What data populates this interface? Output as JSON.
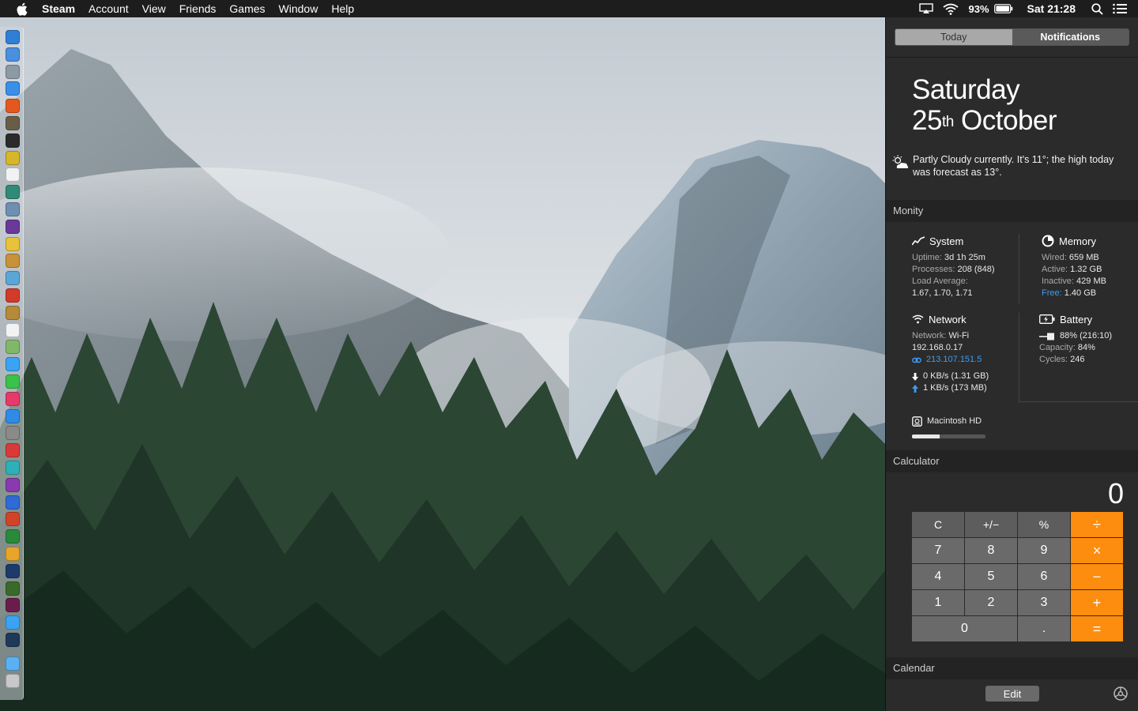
{
  "menubar": {
    "app_name": "Steam",
    "items": [
      "Account",
      "View",
      "Friends",
      "Games",
      "Window",
      "Help"
    ],
    "battery_percent": "93%",
    "clock": "Sat 21:28"
  },
  "notification_center": {
    "tabs": {
      "today": "Today",
      "notifications": "Notifications"
    },
    "date": {
      "weekday": "Saturday",
      "day": "25",
      "suffix": "th",
      "month": "October"
    },
    "weather": "Partly Cloudy currently. It's 11°; the high today was forecast as 13°.",
    "monity": {
      "header": "Monity",
      "system": {
        "title": "System",
        "uptime_label": "Uptime:",
        "uptime": "3d 1h 25m",
        "processes_label": "Processes:",
        "processes": "208 (848)",
        "load_label": "Load Average:",
        "load": "1.67, 1.70, 1.71"
      },
      "memory": {
        "title": "Memory",
        "wired_label": "Wired:",
        "wired": "659 MB",
        "active_label": "Active:",
        "active": "1.32 GB",
        "inactive_label": "Inactive:",
        "inactive": "429 MB",
        "free_label": "Free:",
        "free": "1.40 GB"
      },
      "network": {
        "title": "Network",
        "network_label": "Network:",
        "network": "Wi-Fi",
        "local_ip": "192.168.0.17",
        "public_ip": "213.107.151.5",
        "down": "0 KB/s (1.31 GB)",
        "up": "1 KB/s (173 MB)"
      },
      "battery": {
        "title": "Battery",
        "level": "88% (216:10)",
        "capacity_label": "Capacity:",
        "capacity": "84%",
        "cycles_label": "Cycles:",
        "cycles": "246"
      },
      "disk": {
        "name": "Macintosh HD",
        "used_fraction": 0.38
      }
    },
    "calculator": {
      "header": "Calculator",
      "display": "0",
      "keys": [
        {
          "label": "C",
          "kind": "fn"
        },
        {
          "label": "+/−",
          "kind": "fn"
        },
        {
          "label": "%",
          "kind": "fn"
        },
        {
          "label": "÷",
          "kind": "op"
        },
        {
          "label": "7",
          "kind": "num"
        },
        {
          "label": "8",
          "kind": "num"
        },
        {
          "label": "9",
          "kind": "num"
        },
        {
          "label": "×",
          "kind": "op"
        },
        {
          "label": "4",
          "kind": "num"
        },
        {
          "label": "5",
          "kind": "num"
        },
        {
          "label": "6",
          "kind": "num"
        },
        {
          "label": "−",
          "kind": "op"
        },
        {
          "label": "1",
          "kind": "num"
        },
        {
          "label": "2",
          "kind": "num"
        },
        {
          "label": "3",
          "kind": "num"
        },
        {
          "label": "+",
          "kind": "op"
        },
        {
          "label": "0",
          "kind": "num-wide"
        },
        {
          "label": ".",
          "kind": "num"
        },
        {
          "label": "=",
          "kind": "op"
        }
      ]
    },
    "calendar_header": "Calendar",
    "edit_label": "Edit"
  },
  "dock": {
    "icons": [
      {
        "name": "safari-icon",
        "color": "#2f7fd6"
      },
      {
        "name": "finder-icon",
        "color": "#4a8fe0"
      },
      {
        "name": "launchpad-icon",
        "color": "#8c9aa6"
      },
      {
        "name": "safari-compass-icon",
        "color": "#3a8fe6"
      },
      {
        "name": "firefox-icon",
        "color": "#e5581d"
      },
      {
        "name": "app-icon",
        "color": "#6a5d48"
      },
      {
        "name": "app-icon",
        "color": "#2b2b2b"
      },
      {
        "name": "app-icon",
        "color": "#d8b62a"
      },
      {
        "name": "app-icon",
        "color": "#f2f2f2"
      },
      {
        "name": "app-icon",
        "color": "#2f8b76"
      },
      {
        "name": "app-icon",
        "color": "#6e8fb0"
      },
      {
        "name": "app-icon",
        "color": "#6a3a9a"
      },
      {
        "name": "app-icon",
        "color": "#e8c23a"
      },
      {
        "name": "app-icon",
        "color": "#c8923a"
      },
      {
        "name": "app-icon",
        "color": "#5ba6d6"
      },
      {
        "name": "app-icon",
        "color": "#d23a2a"
      },
      {
        "name": "app-icon",
        "color": "#b58a3a"
      },
      {
        "name": "calendar-icon",
        "color": "#f2f2f2"
      },
      {
        "name": "maps-icon",
        "color": "#7fb86a"
      },
      {
        "name": "messages-icon",
        "color": "#3aa3f2"
      },
      {
        "name": "facetime-icon",
        "color": "#3ac24a"
      },
      {
        "name": "itunes-icon",
        "color": "#e53a6a"
      },
      {
        "name": "app-store-icon",
        "color": "#2f8be6"
      },
      {
        "name": "system-preferences-icon",
        "color": "#8a8a8a"
      },
      {
        "name": "app-icon",
        "color": "#d83a3a"
      },
      {
        "name": "app-icon",
        "color": "#2fb0b8"
      },
      {
        "name": "onenote-icon",
        "color": "#8a3ab0"
      },
      {
        "name": "word-icon",
        "color": "#2f6ad6"
      },
      {
        "name": "powerpoint-icon",
        "color": "#d2442a"
      },
      {
        "name": "excel-icon",
        "color": "#2a8a3a"
      },
      {
        "name": "outlook-icon",
        "color": "#e8a52a"
      },
      {
        "name": "photoshop-icon",
        "color": "#1d3a6a"
      },
      {
        "name": "dreamweaver-icon",
        "color": "#3a6a2a"
      },
      {
        "name": "indesign-icon",
        "color": "#6a1d4a"
      },
      {
        "name": "twitter-icon",
        "color": "#3aa3f2"
      },
      {
        "name": "steam-icon",
        "color": "#1d3a5a"
      },
      {
        "name": "folder-icon",
        "color": "#5ab0f2"
      },
      {
        "name": "trash-icon",
        "color": "#c8c8c8"
      }
    ]
  }
}
